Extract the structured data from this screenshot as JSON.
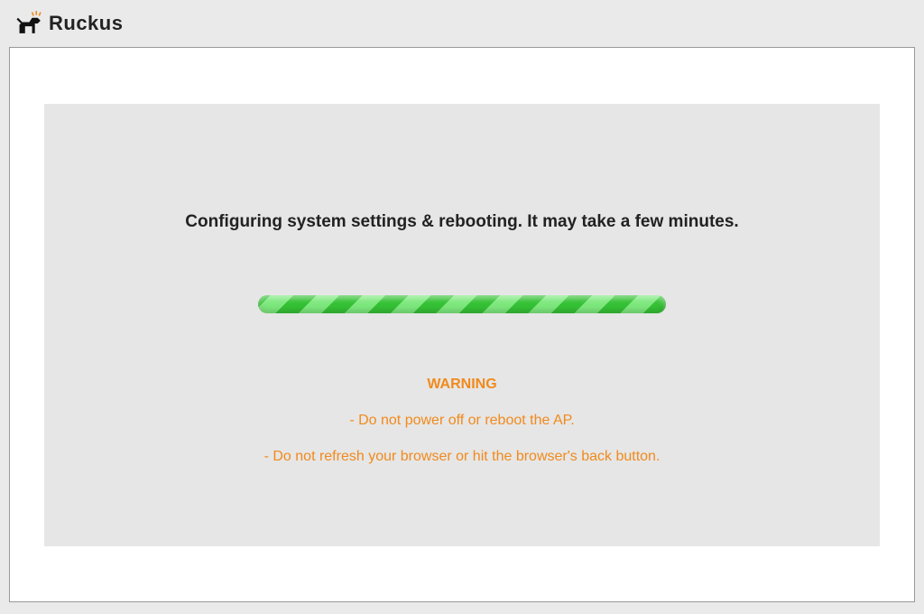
{
  "brand": "Ruckus",
  "status": "Configuring system settings & rebooting. It may take a few minutes.",
  "warning": {
    "title": "WARNING",
    "line1": "- Do not power off or reboot the AP.",
    "line2": "- Do not refresh your browser or hit the browser's back button."
  }
}
